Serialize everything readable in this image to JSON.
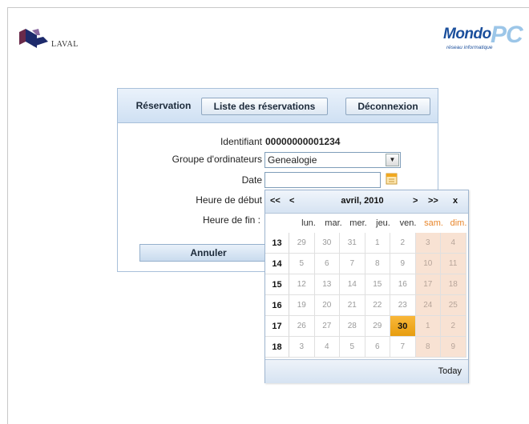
{
  "logos": {
    "laval_text": "LAVAL",
    "mondo_text_1": "Mondo",
    "mondo_text_2": "PC",
    "mondo_tagline": "réseau informatique"
  },
  "nav": {
    "reservation": "Réservation",
    "liste": "Liste des réservations",
    "deconnexion": "Déconnexion"
  },
  "form": {
    "identifiant_label": "Identifiant",
    "identifiant_value": "00000000001234",
    "groupe_label": "Groupe d'ordinateurs",
    "groupe_value": "Genealogie",
    "date_label": "Date",
    "date_value": "",
    "heure_debut_label": "Heure de début",
    "heure_fin_label": "Heure de fin :",
    "annuler": "Annuler"
  },
  "calendar": {
    "prev_year": "<<",
    "prev_month": "<",
    "month_title": "avril, 2010",
    "next_month": ">",
    "next_year": ">>",
    "close": "x",
    "day_names": [
      "lun.",
      "mar.",
      "mer.",
      "jeu.",
      "ven.",
      "sam.",
      "dim."
    ],
    "weeks": [
      {
        "week": "13",
        "days": [
          "29",
          "30",
          "31",
          "1",
          "2",
          "3",
          "4"
        ]
      },
      {
        "week": "14",
        "days": [
          "5",
          "6",
          "7",
          "8",
          "9",
          "10",
          "11"
        ]
      },
      {
        "week": "15",
        "days": [
          "12",
          "13",
          "14",
          "15",
          "16",
          "17",
          "18"
        ]
      },
      {
        "week": "16",
        "days": [
          "19",
          "20",
          "21",
          "22",
          "23",
          "24",
          "25"
        ]
      },
      {
        "week": "17",
        "days": [
          "26",
          "27",
          "28",
          "29",
          "30",
          "1",
          "2"
        ]
      },
      {
        "week": "18",
        "days": [
          "3",
          "4",
          "5",
          "6",
          "7",
          "8",
          "9"
        ]
      }
    ],
    "selected_day": "30",
    "today_label": "Today",
    "colors": {
      "weekend_bg": "#f8e2d3",
      "today_bg": "#f0a820",
      "weekend_text": "#e8862b"
    }
  }
}
